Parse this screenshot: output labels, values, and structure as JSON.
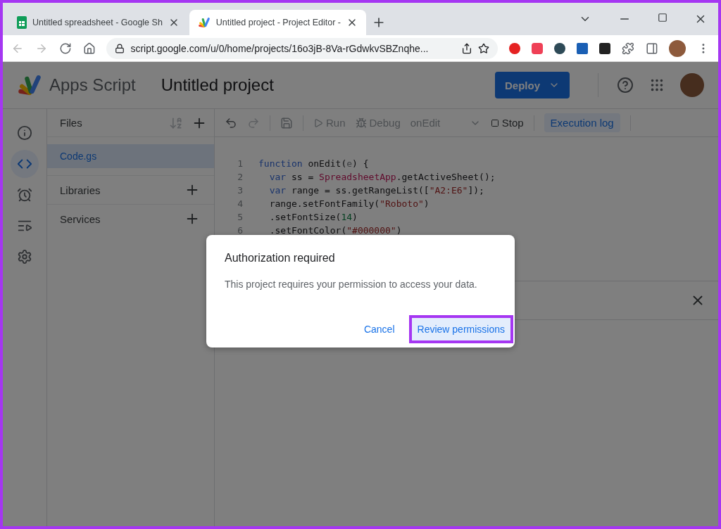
{
  "browser": {
    "tabs": [
      {
        "title": "Untitled spreadsheet - Google Sh",
        "kind": "sheets",
        "selected": false
      },
      {
        "title": "Untitled project - Project Editor -",
        "kind": "script",
        "selected": true
      }
    ],
    "address": "script.google.com/u/0/home/projects/16o3jB-8Va-rGdwkvSBZnqhe..."
  },
  "app": {
    "product": "Apps Script",
    "project_title": "Untitled project",
    "deploy": "Deploy"
  },
  "rail": [
    {
      "kind": "info",
      "selected": false
    },
    {
      "kind": "code",
      "selected": true
    },
    {
      "kind": "triggers",
      "selected": false
    },
    {
      "kind": "executions",
      "selected": false
    },
    {
      "kind": "settings",
      "selected": false
    }
  ],
  "files": {
    "title": "Files",
    "items": [
      {
        "name": "Code.gs",
        "selected": true
      }
    ],
    "sections": [
      {
        "name": "Libraries"
      },
      {
        "name": "Services"
      }
    ]
  },
  "toolbar": {
    "run": "Run",
    "debug": "Debug",
    "function": "onEdit",
    "stop": "Stop",
    "log": "Execution log",
    "log_selected": true
  },
  "code": {
    "lines": [
      {
        "number": "1",
        "tokens": [
          {
            "kind": "keyword",
            "text": "function"
          },
          {
            "kind": "plain",
            "text": " onEdit("
          },
          {
            "kind": "param",
            "text": "e"
          },
          {
            "kind": "plain",
            "text": ") {"
          }
        ]
      },
      {
        "number": "2",
        "tokens": [
          {
            "kind": "keyword",
            "text": "  var"
          },
          {
            "kind": "plain",
            "text": " ss = "
          },
          {
            "kind": "class",
            "text": "SpreadsheetApp"
          },
          {
            "kind": "plain",
            "text": ".getActiveSheet();"
          }
        ]
      },
      {
        "number": "3",
        "tokens": [
          {
            "kind": "keyword",
            "text": "  var"
          },
          {
            "kind": "plain",
            "text": " range = ss.getRangeList(["
          },
          {
            "kind": "string",
            "text": "\"A2:E6\""
          },
          {
            "kind": "plain",
            "text": "]);"
          }
        ]
      },
      {
        "number": "4",
        "tokens": [
          {
            "kind": "plain",
            "text": "  range.setFontFamily("
          },
          {
            "kind": "string",
            "text": "\"Roboto\""
          },
          {
            "kind": "plain",
            "text": ")"
          }
        ]
      },
      {
        "number": "5",
        "tokens": [
          {
            "kind": "plain",
            "text": "  .setFontSize("
          },
          {
            "kind": "number",
            "text": "14"
          },
          {
            "kind": "plain",
            "text": ")"
          }
        ]
      },
      {
        "number": "6",
        "tokens": [
          {
            "kind": "plain",
            "text": "  .setFontColor("
          },
          {
            "kind": "string",
            "text": "\"#000000\""
          },
          {
            "kind": "plain",
            "text": ")"
          }
        ]
      }
    ]
  },
  "dialog": {
    "title": "Authorization required",
    "message": "This project requires your permission to access your data.",
    "buttons": [
      {
        "label": "Cancel",
        "kind": "text",
        "highlighted": false
      },
      {
        "label": "Review permissions",
        "kind": "tonal",
        "highlighted": true
      }
    ]
  }
}
